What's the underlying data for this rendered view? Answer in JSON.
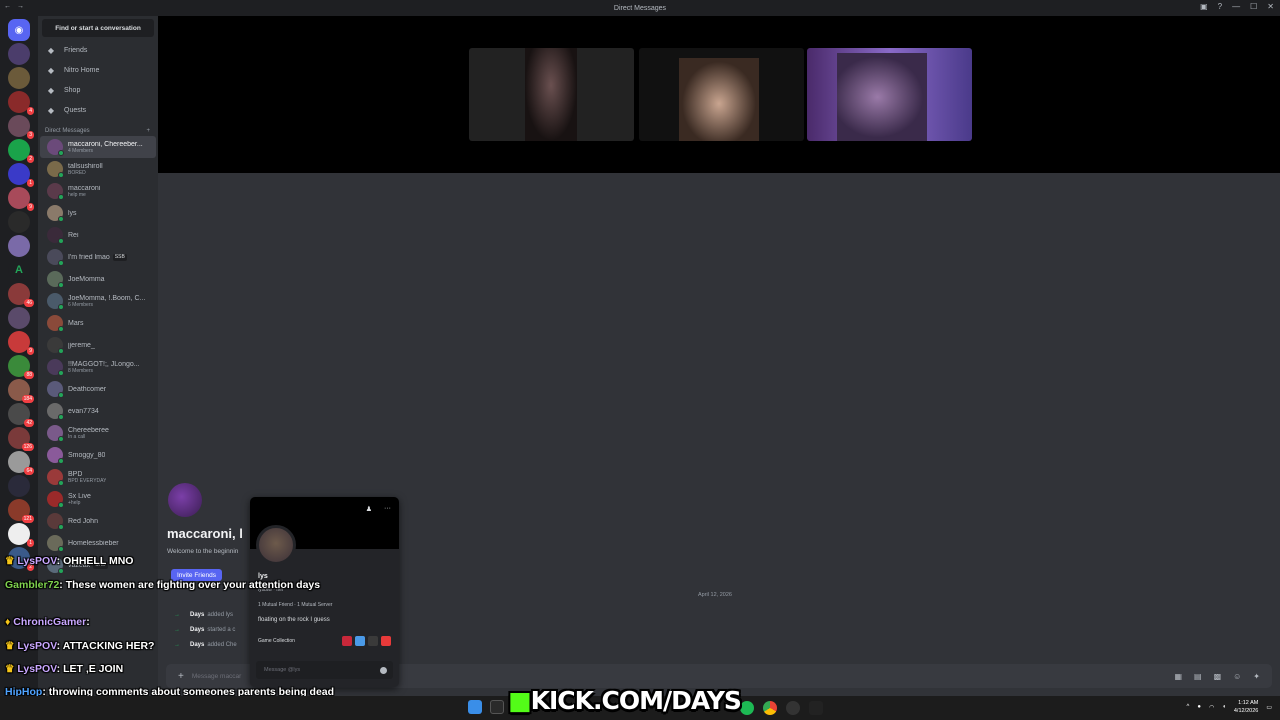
{
  "window": {
    "title": "Direct Messages"
  },
  "sidebar": {
    "search_label": "Find or start a conversation",
    "nav": [
      {
        "label": "Friends",
        "icon": "friends-icon"
      },
      {
        "label": "Nitro Home",
        "icon": "nitro-icon"
      },
      {
        "label": "Shop",
        "icon": "shop-icon"
      },
      {
        "label": "Quests",
        "icon": "quests-icon"
      }
    ],
    "dm_header": "Direct Messages",
    "dms": [
      {
        "name": "maccaroni, Chereeber...",
        "sub": "4 Members",
        "color": "#6b4a7a",
        "active": true
      },
      {
        "name": "tallsushiroll",
        "sub": "BORED",
        "color": "#7a6a4a"
      },
      {
        "name": "maccaroni",
        "sub": "help me",
        "color": "#5a3a4a"
      },
      {
        "name": "lys",
        "sub": "",
        "color": "#8a7a6a"
      },
      {
        "name": "Rei",
        "sub": "",
        "color": "#3a2a3a"
      },
      {
        "name": "I'm fried lmao",
        "sub": "",
        "tag": "SSB",
        "color": "#4a4a5a"
      },
      {
        "name": "JoeMomma",
        "sub": "",
        "color": "#5a6a5a"
      },
      {
        "name": "JoeMomma, !.Boom, C...",
        "sub": "6 Members",
        "color": "#4a5a6a"
      },
      {
        "name": "Mars",
        "sub": "",
        "color": "#8a4a3a"
      },
      {
        "name": "jjereme_",
        "sub": "",
        "color": "#3a3a3a"
      },
      {
        "name": "!!MAGGOT!;, JLongo...",
        "sub": "8 Members",
        "color": "#4a3a5a"
      },
      {
        "name": "Deathcomer",
        "sub": "",
        "color": "#5a5a7a"
      },
      {
        "name": "evan7734",
        "sub": "",
        "color": "#6a6a6a"
      },
      {
        "name": "Chereeberee",
        "sub": "In a call",
        "color": "#7a5a8a"
      },
      {
        "name": "Smoggy_80",
        "sub": "",
        "color": "#8a5a9a"
      },
      {
        "name": "BPD",
        "sub": "BPD EVERYDAY",
        "color": "#9a3a3a"
      },
      {
        "name": "Sx Live",
        "sub": "+help",
        "color": "#9a2a2a"
      },
      {
        "name": "Red John",
        "sub": "",
        "color": "#5a3a3a"
      },
      {
        "name": "Homelessbieber",
        "sub": "",
        "color": "#6a6a5a"
      },
      {
        "name": "vazeak",
        "sub": "",
        "tag": "SHD",
        "color": "#5a6a7a"
      }
    ]
  },
  "chat": {
    "title": "maccaroni, l",
    "welcome": "Welcome to the beginnin",
    "invite_label": "Invite Friends",
    "date": "April 12, 2026",
    "system_messages": [
      {
        "who": "Days",
        "text": "added lys"
      },
      {
        "who": "Days",
        "text": "started a c"
      },
      {
        "who": "Days",
        "text": "added Che"
      }
    ],
    "composer_placeholder": "Message maccar"
  },
  "profile_popout": {
    "name": "lys",
    "username": "lysbtw · her",
    "mutual": "1 Mutual Friend · 1 Mutual Server",
    "bio": "floating on the rock I guess",
    "games_label": "Game Collection",
    "message_placeholder": "Message @lys"
  },
  "stream_overlay": {
    "chat": [
      {
        "user": "LysPOV",
        "text": "OHHELL MNO",
        "color": "#c9a7ff"
      },
      {
        "user": "Gambler72",
        "text": "These women are fighting over your attention days",
        "color": "#7fd34e"
      },
      {
        "user": "ChronicGamer",
        "text": "",
        "color": "#c9a7ff"
      },
      {
        "user": "LysPOV",
        "text": "ATTACKING HER?",
        "color": "#c9a7ff"
      },
      {
        "user": "LysPOV",
        "text": "LET ,E JOIN",
        "color": "#c9a7ff"
      },
      {
        "user": "HipHop",
        "text": "throwing comments about someones parents being dead is wild",
        "color": "#4fa3ff"
      }
    ],
    "kick_banner": "KICK.COM/DAYS"
  },
  "taskbar": {
    "time": "1:12 AM",
    "date": "4/12/2026"
  },
  "colors": {
    "accent": "#5865f2",
    "online": "#23a559",
    "kick_green": "#53fc18"
  }
}
